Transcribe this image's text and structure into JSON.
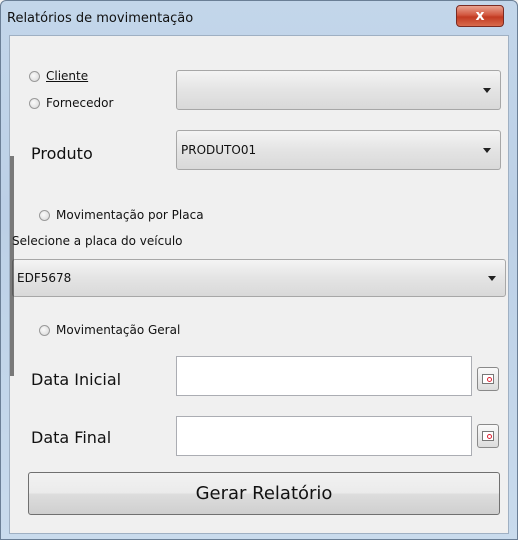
{
  "window": {
    "title": "Relatórios de movimentação",
    "close_glyph": "x"
  },
  "entity": {
    "options": [
      {
        "label": "Cliente",
        "checked": false
      },
      {
        "label": "Fornecedor",
        "checked": false
      }
    ],
    "select_value": ""
  },
  "produto": {
    "label": "Produto",
    "value": "PRODUTO01"
  },
  "placa": {
    "radio_label": "Movimentação por Placa",
    "select_label": "Selecione a placa do veículo",
    "value": "EDF5678"
  },
  "geral": {
    "radio_label": "Movimentação Geral"
  },
  "dates": {
    "start_label": "Data Inicial",
    "start_value": "",
    "end_label": "Data Final",
    "end_value": ""
  },
  "actions": {
    "generate_label": "Gerar Relatório"
  },
  "icons": {
    "calendar": "calendar-icon",
    "dropdown": "chevron-down-icon"
  },
  "colors": {
    "close_button": "#c8432b",
    "window_frame": "#bcd0e6",
    "client_bg": "#f0f0f0"
  }
}
